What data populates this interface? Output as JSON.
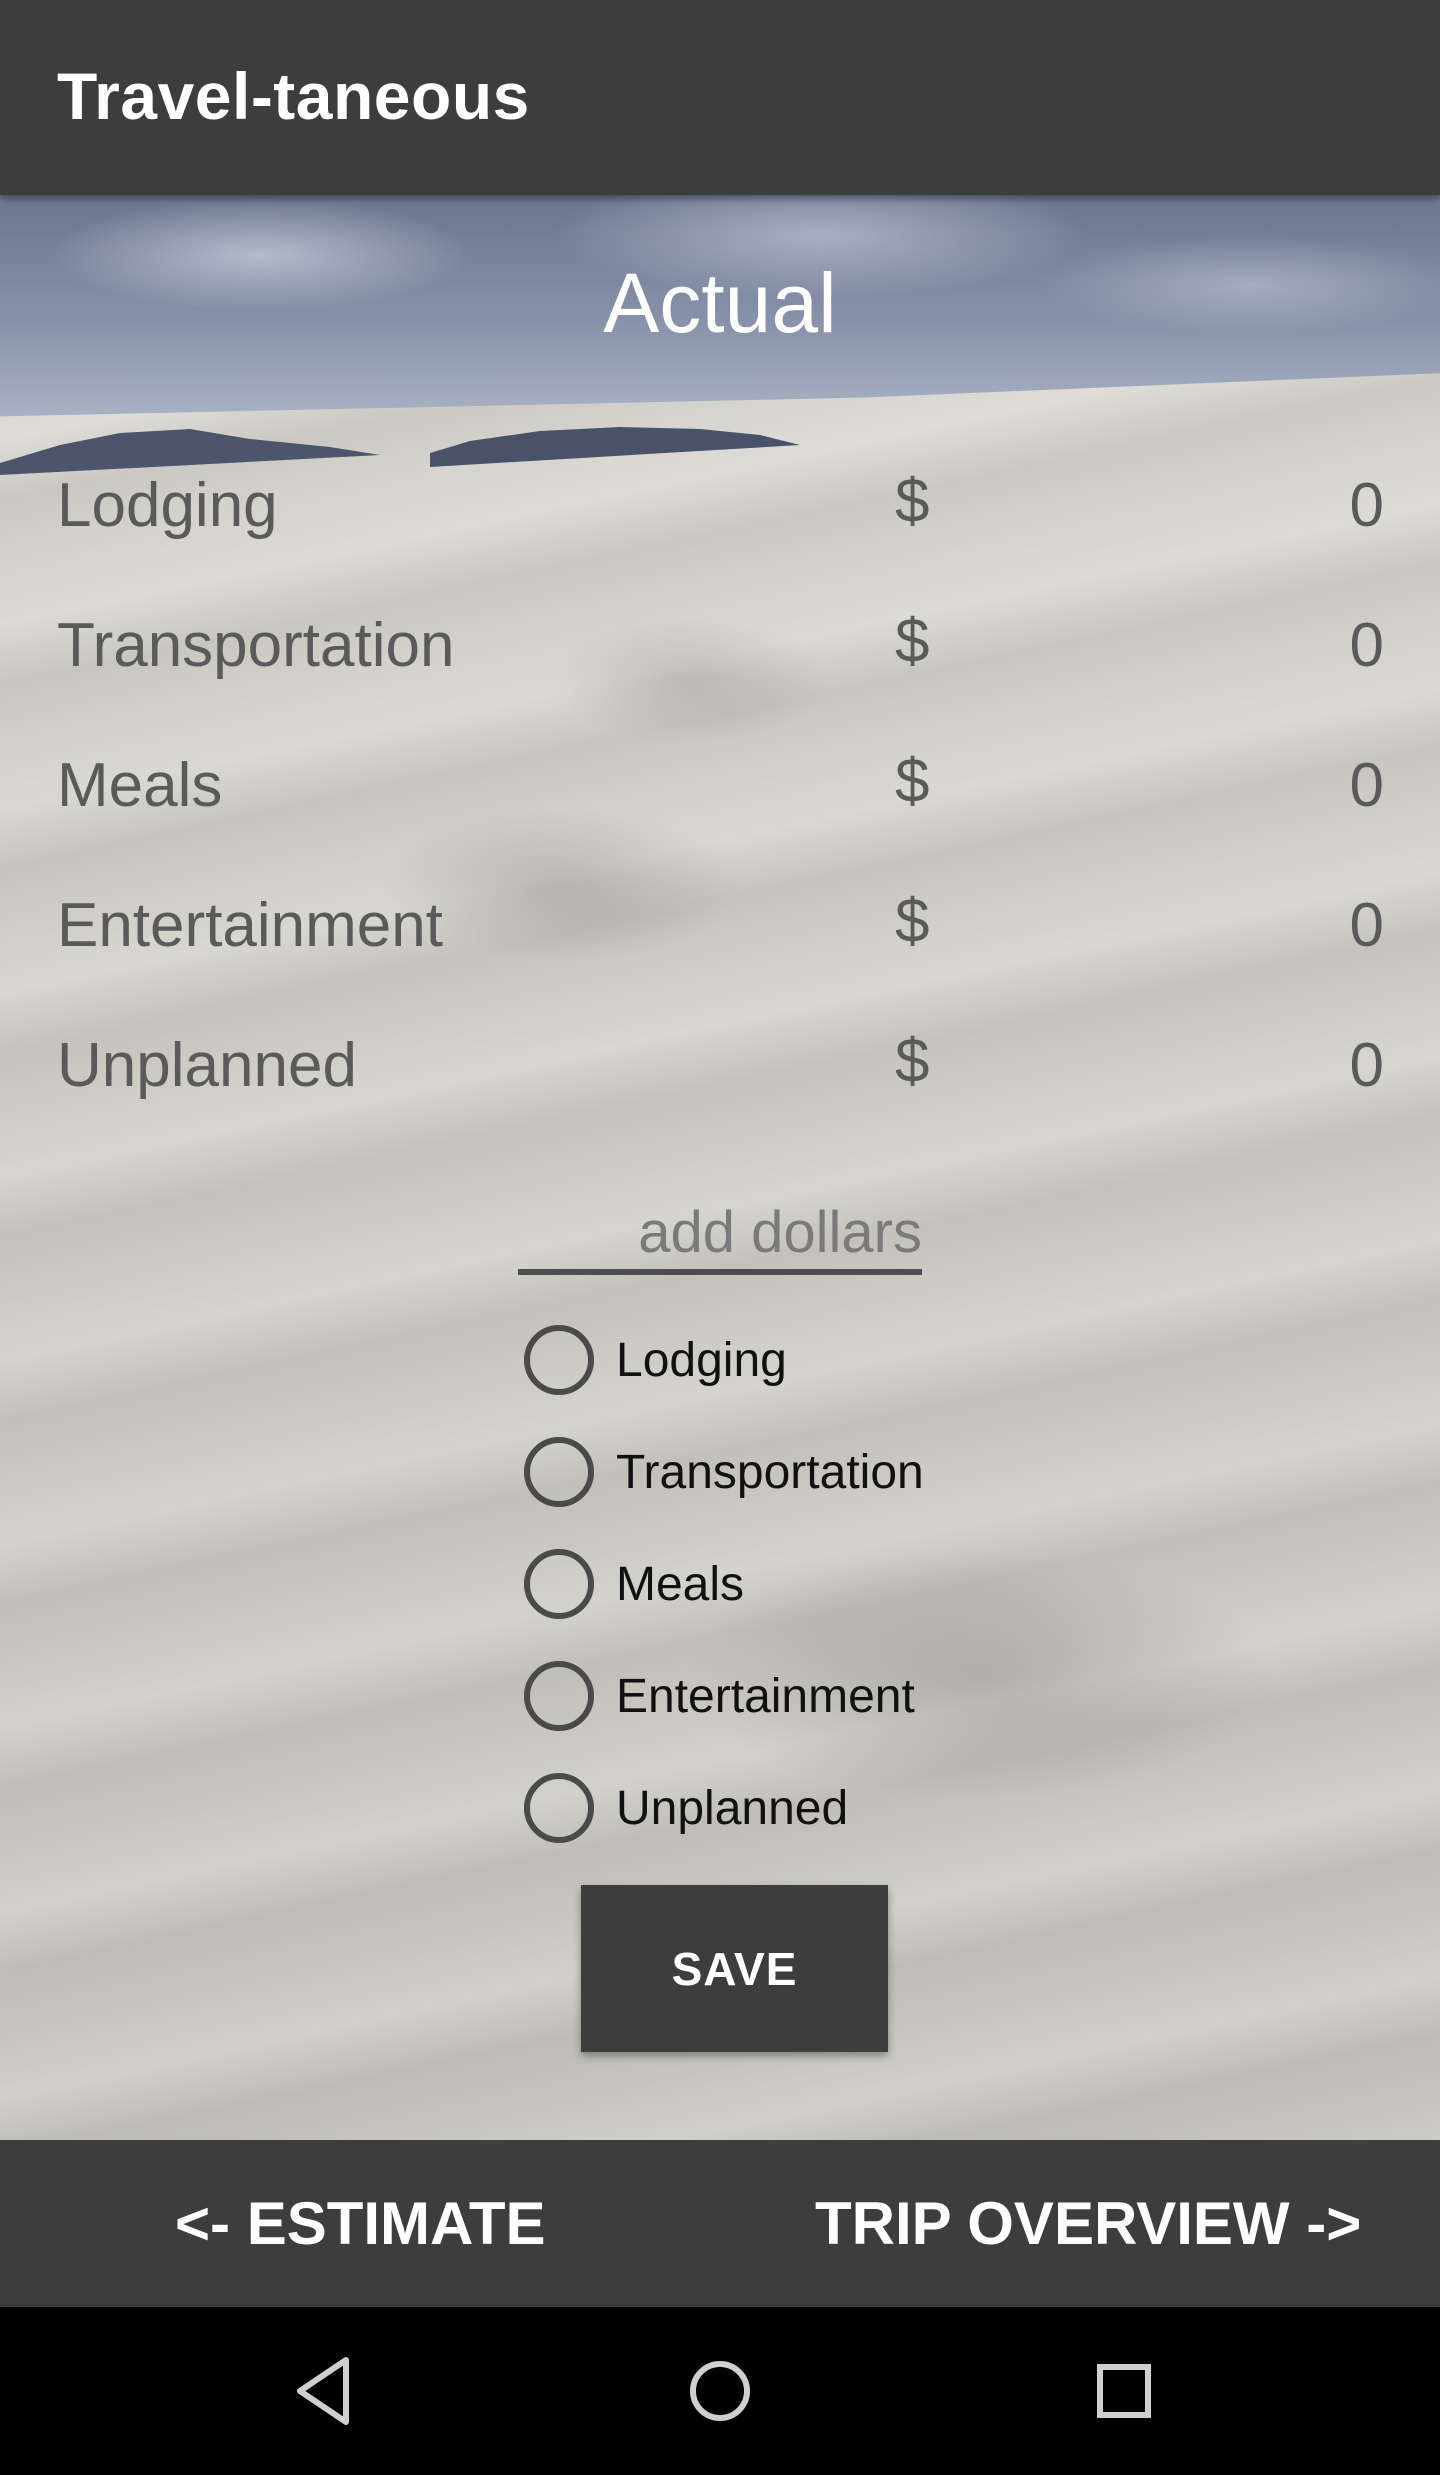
{
  "app_bar": {
    "title": "Travel-taneous"
  },
  "main": {
    "heading": "Actual",
    "categories": [
      {
        "label": "Lodging",
        "currency": "$",
        "value": "0"
      },
      {
        "label": "Transportation",
        "currency": "$",
        "value": "0"
      },
      {
        "label": "Meals",
        "currency": "$",
        "value": "0"
      },
      {
        "label": "Entertainment",
        "currency": "$",
        "value": "0"
      },
      {
        "label": "Unplanned",
        "currency": "$",
        "value": "0"
      }
    ],
    "amount_input": {
      "placeholder": "add dollars",
      "value": ""
    },
    "radio_options": [
      {
        "label": "Lodging",
        "checked": false
      },
      {
        "label": "Transportation",
        "checked": false
      },
      {
        "label": "Meals",
        "checked": false
      },
      {
        "label": "Entertainment",
        "checked": false
      },
      {
        "label": "Unplanned",
        "checked": false
      }
    ],
    "save_label": "SAVE"
  },
  "bottom_nav": {
    "prev_label": "<- ESTIMATE",
    "next_label": "TRIP OVERVIEW ->"
  },
  "system_nav": {
    "icons": [
      "back-icon",
      "home-icon",
      "recents-icon"
    ]
  },
  "colors": {
    "bar_background": "#3d3d3d",
    "text_on_bar": "#ffffff",
    "category_text": "#5a5a5a"
  }
}
